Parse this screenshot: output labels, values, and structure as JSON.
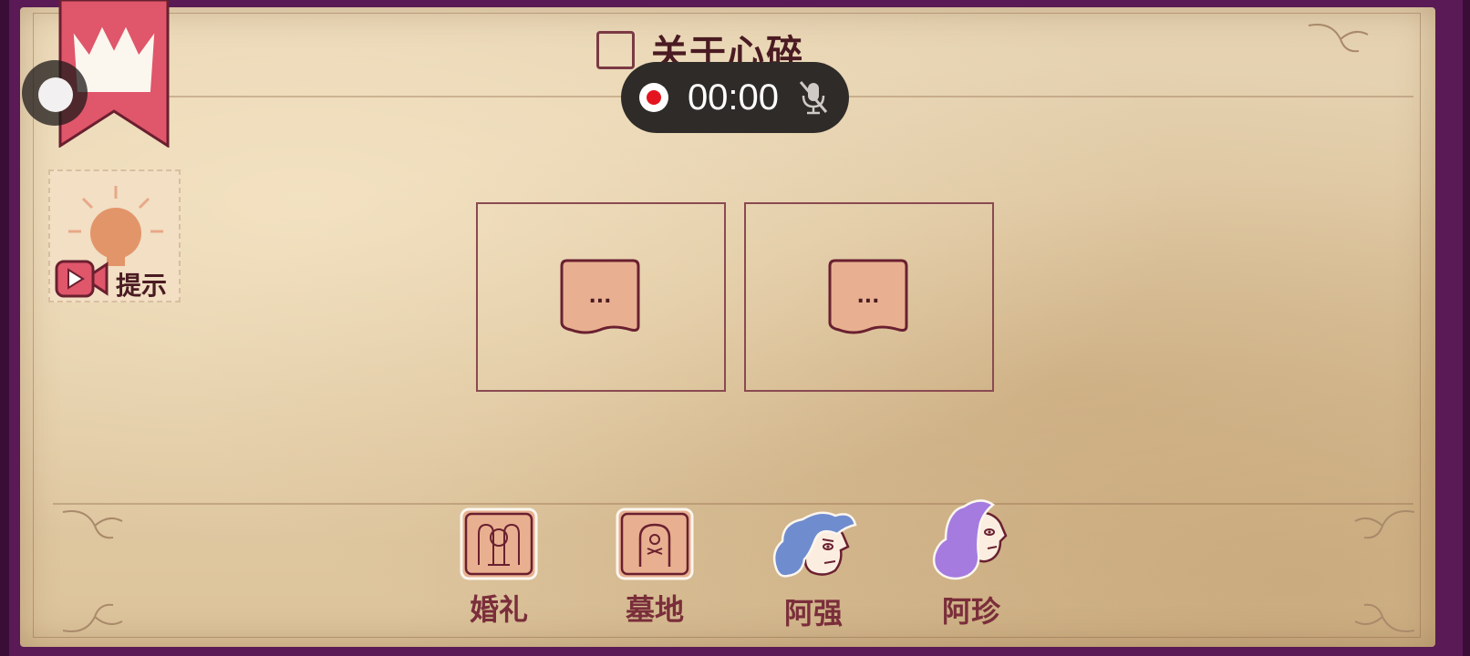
{
  "header": {
    "title": "关于心碎"
  },
  "recorder": {
    "time": "00:00"
  },
  "hint": {
    "label": "提示"
  },
  "slots": [
    {
      "label": "..."
    },
    {
      "label": "..."
    }
  ],
  "items": [
    {
      "label": "婚礼",
      "icon": "wedding-card-icon"
    },
    {
      "label": "墓地",
      "icon": "graveyard-card-icon"
    },
    {
      "label": "阿强",
      "icon": "aqiang-portrait-icon"
    },
    {
      "label": "阿珍",
      "icon": "azhen-portrait-icon"
    }
  ],
  "colors": {
    "frame": "#5a1a55",
    "parchment": "#e2cda8",
    "ink": "#4a1b22",
    "accent": "#e0566a",
    "label": "#7a2e3a"
  }
}
